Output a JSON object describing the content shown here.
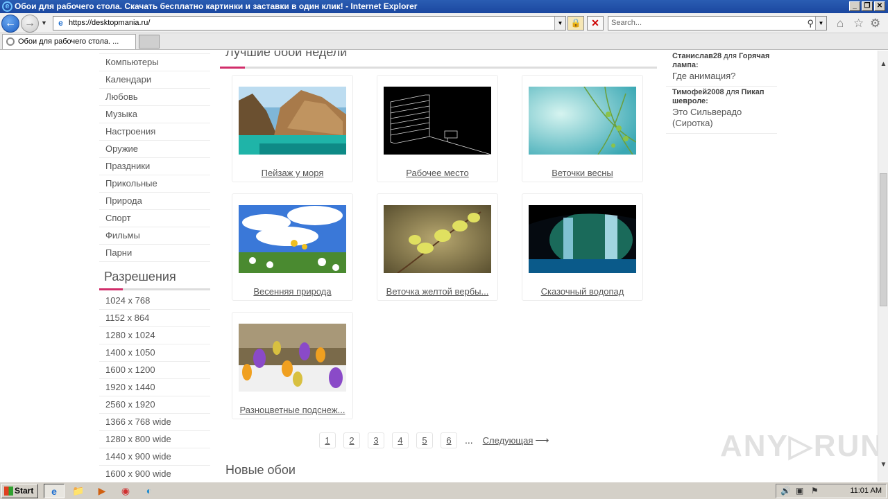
{
  "window": {
    "title": "Обои для рабочего стола. Скачать бесплатно картинки и заставки в один клик! - Internet Explorer",
    "min": "_",
    "max": "❐",
    "close": "✕"
  },
  "address": {
    "url": "https://desktopmania.ru/",
    "search_placeholder": "Search..."
  },
  "tab": {
    "label": "Обои для рабочего стола. ..."
  },
  "sidebar": {
    "categories": [
      "Компьютеры",
      "Календари",
      "Любовь",
      "Музыка",
      "Настроения",
      "Оружие",
      "Праздники",
      "Прикольные",
      "Природа",
      "Спорт",
      "Фильмы",
      "Парни"
    ],
    "resolutions_title": "Разрешения",
    "resolutions": [
      "1024 x 768",
      "1152 x 864",
      "1280 x 1024",
      "1400 x 1050",
      "1600 x 1200",
      "1920 x 1440",
      "2560 x 1920",
      "1366 x 768 wide",
      "1280 x 800 wide",
      "1440 x 900 wide",
      "1600 x 900 wide"
    ]
  },
  "main": {
    "title": "Лучшие обои недели",
    "wallpapers": [
      {
        "caption": "Пейзаж у моря"
      },
      {
        "caption": "Рабочее место"
      },
      {
        "caption": "Веточки весны"
      },
      {
        "caption": "Весенняя природа"
      },
      {
        "caption": "Веточка желтой вербы..."
      },
      {
        "caption": "Сказочный водопад"
      },
      {
        "caption": "Разноцветные подснеж..."
      }
    ],
    "pager": {
      "pages": [
        "1",
        "2",
        "3",
        "4",
        "5",
        "6"
      ],
      "dots": "...",
      "next": "Следующая",
      "arrow": "⟶"
    },
    "new_title": "Новые обои"
  },
  "comments": [
    {
      "user": "Станислав28",
      "for": "для",
      "item": "Горячая лампа:",
      "text": "Где анимация?"
    },
    {
      "user": "Тимофей2008",
      "for": "для",
      "item": "Пикап шевроле:",
      "text": "Это Сильверадо (Сиротка)"
    }
  ],
  "watermark": "ANY▷RUN",
  "taskbar": {
    "start": "Start",
    "time": "11:01 AM"
  },
  "colors": {
    "accent": "#d12d6a",
    "title_bar": "#1b47a0"
  }
}
